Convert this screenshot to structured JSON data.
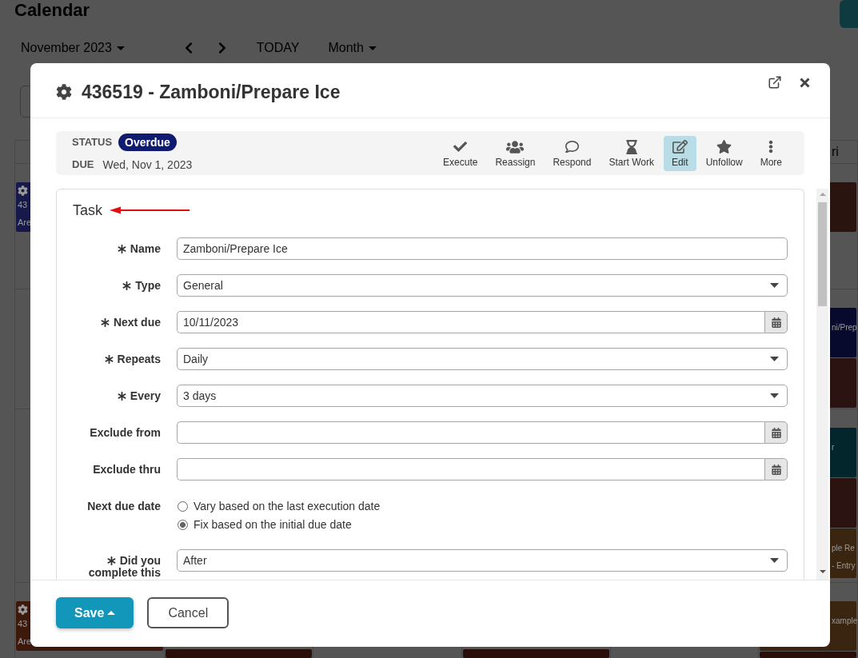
{
  "calendar": {
    "title": "Calendar",
    "month_picker": "November 2023",
    "today_button": "TODAY",
    "view_picker": "Month",
    "day_header": "ri",
    "weeks": [
      {
        "sun": [
          {
            "kind": "task",
            "color": "#17194a",
            "lines": [
              "43",
              "Are"
            ]
          }
        ],
        "fri": [
          {
            "kind": "plain",
            "color": "#2a1410"
          }
        ]
      },
      {
        "fri": [
          {
            "kind": "plain",
            "color": "#070a2c",
            "lines": [
              "ni/Prep"
            ]
          },
          {
            "kind": "plain",
            "color": "#2a1310"
          }
        ]
      },
      {
        "fri": [
          {
            "kind": "plain",
            "color": "#03262c",
            "lines": [
              "r"
            ]
          },
          {
            "kind": "plain",
            "color": "#2a1310"
          },
          {
            "kind": "plain",
            "color": "#3a2510",
            "lines": [
              "ple Re",
              "- Entry"
            ]
          }
        ]
      },
      {
        "sun": [
          {
            "kind": "task",
            "color": "#3c190a",
            "lines": [
              "43",
              "Are"
            ]
          }
        ],
        "mon": [
          {
            "kind": "timed",
            "color": "#2a0e0a"
          }
        ],
        "wed": [
          {
            "kind": "timed",
            "color": "#2a0e0a"
          }
        ],
        "fri": [
          {
            "kind": "plain",
            "color": "#3a2510",
            "lines": [
              "xample"
            ]
          },
          {
            "kind": "timed",
            "color": "#2a0e0a"
          }
        ]
      }
    ]
  },
  "dialog": {
    "title": "436519 - Zamboni/Prepare Ice",
    "status": {
      "label": "STATUS",
      "value": "Overdue"
    },
    "due": {
      "label": "DUE",
      "value": "Wed, Nov 1, 2023"
    },
    "actions": [
      {
        "label": "Execute",
        "kind": "execute",
        "selected": false
      },
      {
        "label": "Reassign",
        "kind": "reassign",
        "selected": false
      },
      {
        "label": "Respond",
        "kind": "respond",
        "selected": false
      },
      {
        "label": "Start Work",
        "kind": "start",
        "selected": false
      },
      {
        "label": "Edit",
        "kind": "edit",
        "selected": true
      },
      {
        "label": "Unfollow",
        "kind": "unfollow",
        "selected": false
      },
      {
        "label": "More",
        "kind": "more",
        "selected": false
      }
    ],
    "section": {
      "title": "Task",
      "arrow": true
    },
    "fields": [
      {
        "label": "Name",
        "required": true,
        "kind": "text",
        "value": "Zamboni/Prepare Ice"
      },
      {
        "label": "Type",
        "required": true,
        "kind": "select",
        "value": "General"
      },
      {
        "label": "Next due",
        "required": true,
        "kind": "date",
        "value": "10/11/2023"
      },
      {
        "label": "Repeats",
        "required": true,
        "kind": "select",
        "value": "Daily"
      },
      {
        "label": "Every",
        "required": true,
        "kind": "select",
        "value": "3 days"
      },
      {
        "label": "Exclude from",
        "required": false,
        "kind": "date"
      },
      {
        "label": "Exclude thru",
        "required": false,
        "kind": "date"
      },
      {
        "label": "Next due date",
        "required": false,
        "kind": "radio",
        "options": [
          {
            "label": "Vary based on the last execution date",
            "selected": false
          },
          {
            "label": "Fix based on the initial due date",
            "selected": true
          }
        ]
      },
      {
        "label": "Did you complete this",
        "required": true,
        "kind": "select",
        "value": "After"
      }
    ],
    "buttons": [
      {
        "label": "Save",
        "kind": "save"
      },
      {
        "label": "Cancel",
        "kind": "cancel"
      }
    ]
  }
}
